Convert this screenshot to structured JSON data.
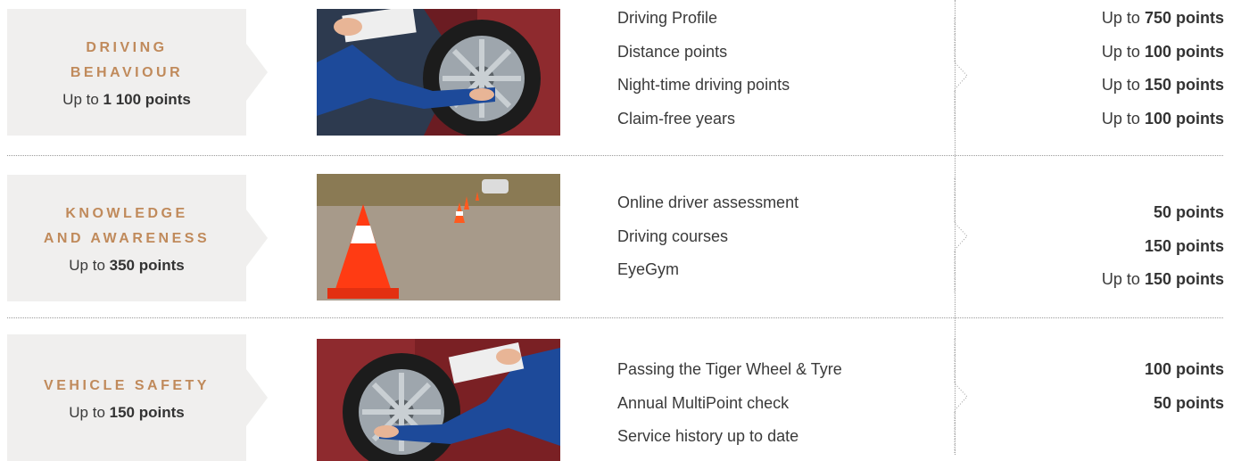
{
  "rows": [
    {
      "category": {
        "title_line1": "DRIVING",
        "title_line2": "BEHAVIOUR",
        "points_prefix": "Up to",
        "points_value": "1 100 points"
      },
      "image": "mechanic-checking-tyre",
      "items": [
        "Driving Profile",
        "Distance points",
        "Night-time driving points",
        "Claim-free years"
      ],
      "values": [
        {
          "prefix": "Up to",
          "value": "750 points"
        },
        {
          "prefix": "Up to",
          "value": "100 points"
        },
        {
          "prefix": "Up to",
          "value": "150 points"
        },
        {
          "prefix": "Up to",
          "value": "100 points"
        }
      ]
    },
    {
      "category": {
        "title_line1": "KNOWLEDGE",
        "title_line2": "AND AWARENESS",
        "points_prefix": "Up to",
        "points_value": "350 points"
      },
      "image": "traffic-cones-on-road",
      "items": [
        "Online driver assessment",
        "Driving courses",
        "EyeGym"
      ],
      "values": [
        {
          "prefix": "",
          "value": "50 points"
        },
        {
          "prefix": "",
          "value": "150 points"
        },
        {
          "prefix": "Up to",
          "value": "150 points"
        }
      ]
    },
    {
      "category": {
        "title_line1": "VEHICLE SAFETY",
        "title_line2": "",
        "points_prefix": "Up to",
        "points_value": "150 points"
      },
      "image": "mechanic-checking-wheel",
      "items": [
        "Passing the Tiger Wheel & Tyre",
        "Annual MultiPoint check",
        "Service history up to date"
      ],
      "values": [
        {
          "prefix": "",
          "value": "100 points"
        },
        {
          "prefix": "",
          "value": ""
        },
        {
          "prefix": "",
          "value": "50 points"
        }
      ]
    }
  ],
  "colors": {
    "accent": "#c08a5b",
    "panel": "#f0efee",
    "text": "#3a3a3a",
    "divider": "#9a9a9a"
  }
}
